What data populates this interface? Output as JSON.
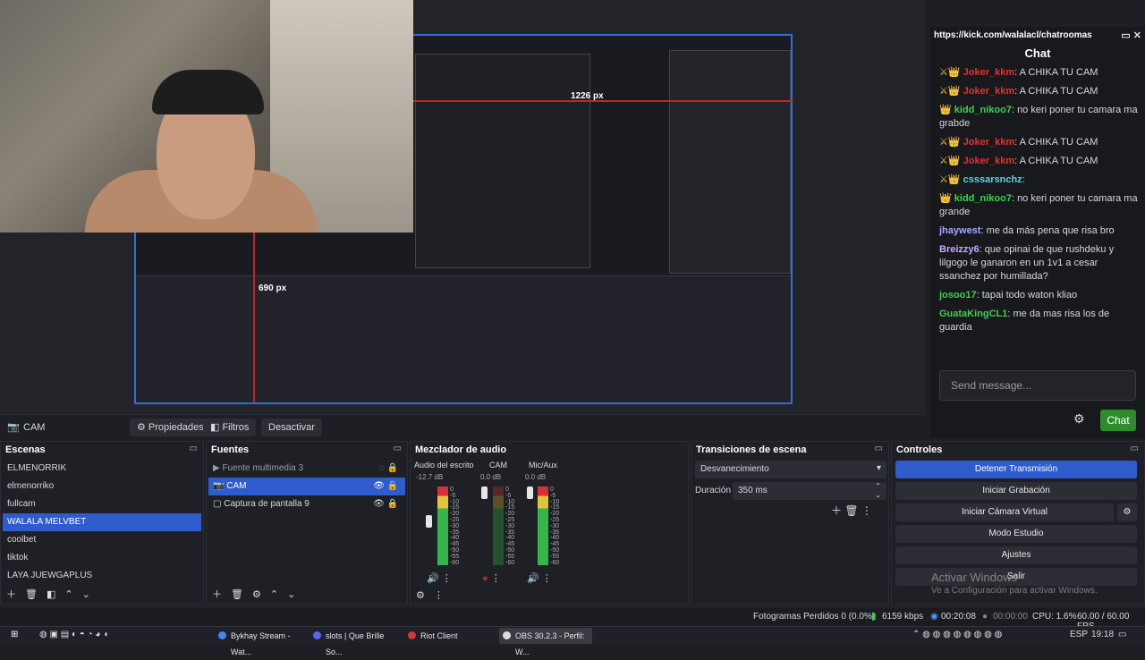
{
  "chat": {
    "url": "https://kick.com/walalacl/chatroomas",
    "title": "Chat",
    "messages": [
      {
        "user": "Joker_kkm",
        "text": ": A CHIKA TU CAM",
        "cls": "u1",
        "badges": "⚔👑"
      },
      {
        "user": "Joker_kkm",
        "text": ": A CHIKA TU CAM",
        "cls": "u1",
        "badges": "⚔👑"
      },
      {
        "user": "kidd_nikoo7",
        "text": ": no keri poner tu camara ma grabde",
        "cls": "u2",
        "badges": "👑"
      },
      {
        "user": "Joker_kkm",
        "text": ": A CHIKA TU CAM",
        "cls": "u1",
        "badges": "⚔👑"
      },
      {
        "user": "Joker_kkm",
        "text": ": A CHIKA TU CAM",
        "cls": "u1",
        "badges": "⚔👑"
      },
      {
        "user": "csssarsnchz",
        "text": ":",
        "cls": "u3",
        "badges": "⚔👑"
      },
      {
        "user": "kidd_nikoo7",
        "text": ": no keri poner tu camara ma grande",
        "cls": "u2",
        "badges": "👑"
      },
      {
        "user": "jhaywest",
        "text": ": me da más pena que risa bro",
        "cls": "u5",
        "badges": ""
      },
      {
        "user": "Breizzy6",
        "text": ": que opinai de que rushdeku y lilgogo le ganaron en un 1v1 a cesar ssanchez por humillada?",
        "cls": "u4",
        "badges": ""
      },
      {
        "user": "josoo17",
        "text": ": tapai todo waton kliao",
        "cls": "u2",
        "badges": ""
      },
      {
        "user": "GuataKingCL1",
        "text": ": me da mas risa los de guardia",
        "cls": "u2",
        "badges": ""
      }
    ],
    "send_placeholder": "Send message...",
    "send_button": "Chat"
  },
  "preview": {
    "px_label_1": "1226 px",
    "px_label_2": "690 px"
  },
  "source_toolbar": {
    "source_name": "CAM",
    "properties": "Propiedades",
    "filters": "Filtros",
    "deactivate": "Desactivar"
  },
  "scenes": {
    "title": "Escenas",
    "items": [
      "ELMENORRIK",
      "elmenorriko",
      "fullcam",
      "WALALA MELVBET",
      "coolbet",
      "tiktok",
      "LAYA JUEWGAPLUS"
    ],
    "selected": 3
  },
  "sources": {
    "title": "Fuentes",
    "items": [
      "Fuente multimedia 3",
      "CAM",
      "Captura de pantalla 9"
    ]
  },
  "mixer": {
    "title": "Mezclador de audio",
    "channels": [
      {
        "name": "Audio del escrito",
        "db": "-12.7 dB"
      },
      {
        "name": "CAM",
        "db": "0.0 dB"
      },
      {
        "name": "Mic/Aux",
        "db": "0.0 dB"
      }
    ],
    "scale": [
      "0",
      "-5",
      "-10",
      "-15",
      "-20",
      "-25",
      "-30",
      "-35",
      "-40",
      "-45",
      "-50",
      "-55",
      "-60"
    ]
  },
  "transitions": {
    "title": "Transiciones de escena",
    "selected": "Desvanecimiento",
    "duration_label": "Duración",
    "duration_value": "350 ms"
  },
  "controls": {
    "title": "Controles",
    "buttons": [
      "Detener Transmisión",
      "Iniciar Grabación",
      "Iniciar Cámara Virtual",
      "Modo Estudio",
      "Ajustes",
      "Salir"
    ]
  },
  "watermark": {
    "line1": "Activar Windows",
    "line2": "Ve a Configuración para activar Windows."
  },
  "status": {
    "dropped": "Fotogramas Perdidos 0 (0.0%)",
    "bitrate": "6159 kbps",
    "stream_time": "00:20:08",
    "rec_time": "00:00:00",
    "cpu": "CPU: 1.6%",
    "fps": "60.00 / 60.00 FPS"
  },
  "taskbar": {
    "tasks": [
      "Bykhay Stream - Wat...",
      "slots | Que Brille So...",
      "Riot Client",
      "OBS 30.2.3 - Perfil: W..."
    ],
    "lang": "ESP",
    "time": "19:18"
  },
  "colors": {
    "accent": "#2f5ccd",
    "live": "#2e8b2e",
    "red": "#c0252c"
  }
}
